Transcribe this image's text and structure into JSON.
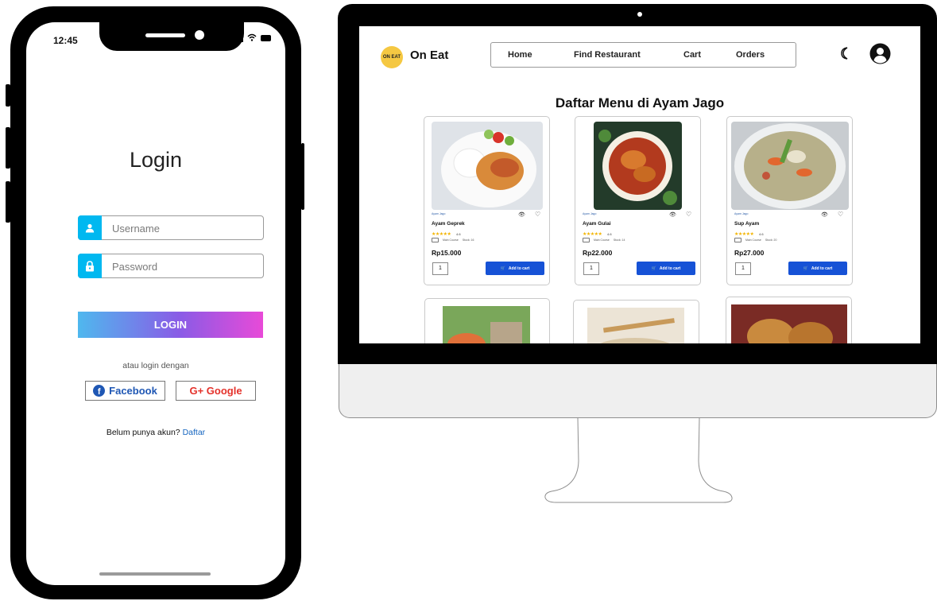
{
  "phone": {
    "status": {
      "time": "12:45"
    },
    "login": {
      "title": "Login",
      "username_placeholder": "Username",
      "password_placeholder": "Password",
      "login_button": "LOGIN",
      "alt_text": "atau login dengan",
      "facebook_label": "Facebook",
      "google_label": "G+ Google",
      "signup_prompt": "Belum punya akun?",
      "signup_link": "Daftar"
    }
  },
  "desktop": {
    "brand": {
      "logo_text": "ON EAT",
      "name": "On Eat"
    },
    "nav": [
      "Home",
      "Find Restaurant",
      "Cart",
      "Orders"
    ],
    "page_title": "Daftar Menu di Ayam Jago",
    "menu_items": [
      {
        "name": "Ayam Geprek",
        "price": "Rp15.000",
        "qty": "1",
        "add_label": "Add to cart",
        "shop": "Ayam Jago",
        "rating": "4.6",
        "stars": "★★★★★",
        "meta1": "Main Course",
        "meta2": "Stock: 16"
      },
      {
        "name": "Ayam Gulai",
        "price": "Rp22.000",
        "qty": "1",
        "add_label": "Add to cart",
        "shop": "Ayam Jago",
        "rating": "4.6",
        "stars": "★★★★★",
        "meta1": "Main Course",
        "meta2": "Stock: 14"
      },
      {
        "name": "Sup Ayam",
        "price": "Rp27.000",
        "qty": "1",
        "add_label": "Add to cart",
        "shop": "Ayam Jago",
        "rating": "4.6",
        "stars": "★★★★★",
        "meta1": "Main Course",
        "meta2": "Stock: 20"
      }
    ],
    "colors": {
      "accent": "#1652d6",
      "logo": "#f5c842",
      "field_icon": "#00b8f0"
    }
  }
}
